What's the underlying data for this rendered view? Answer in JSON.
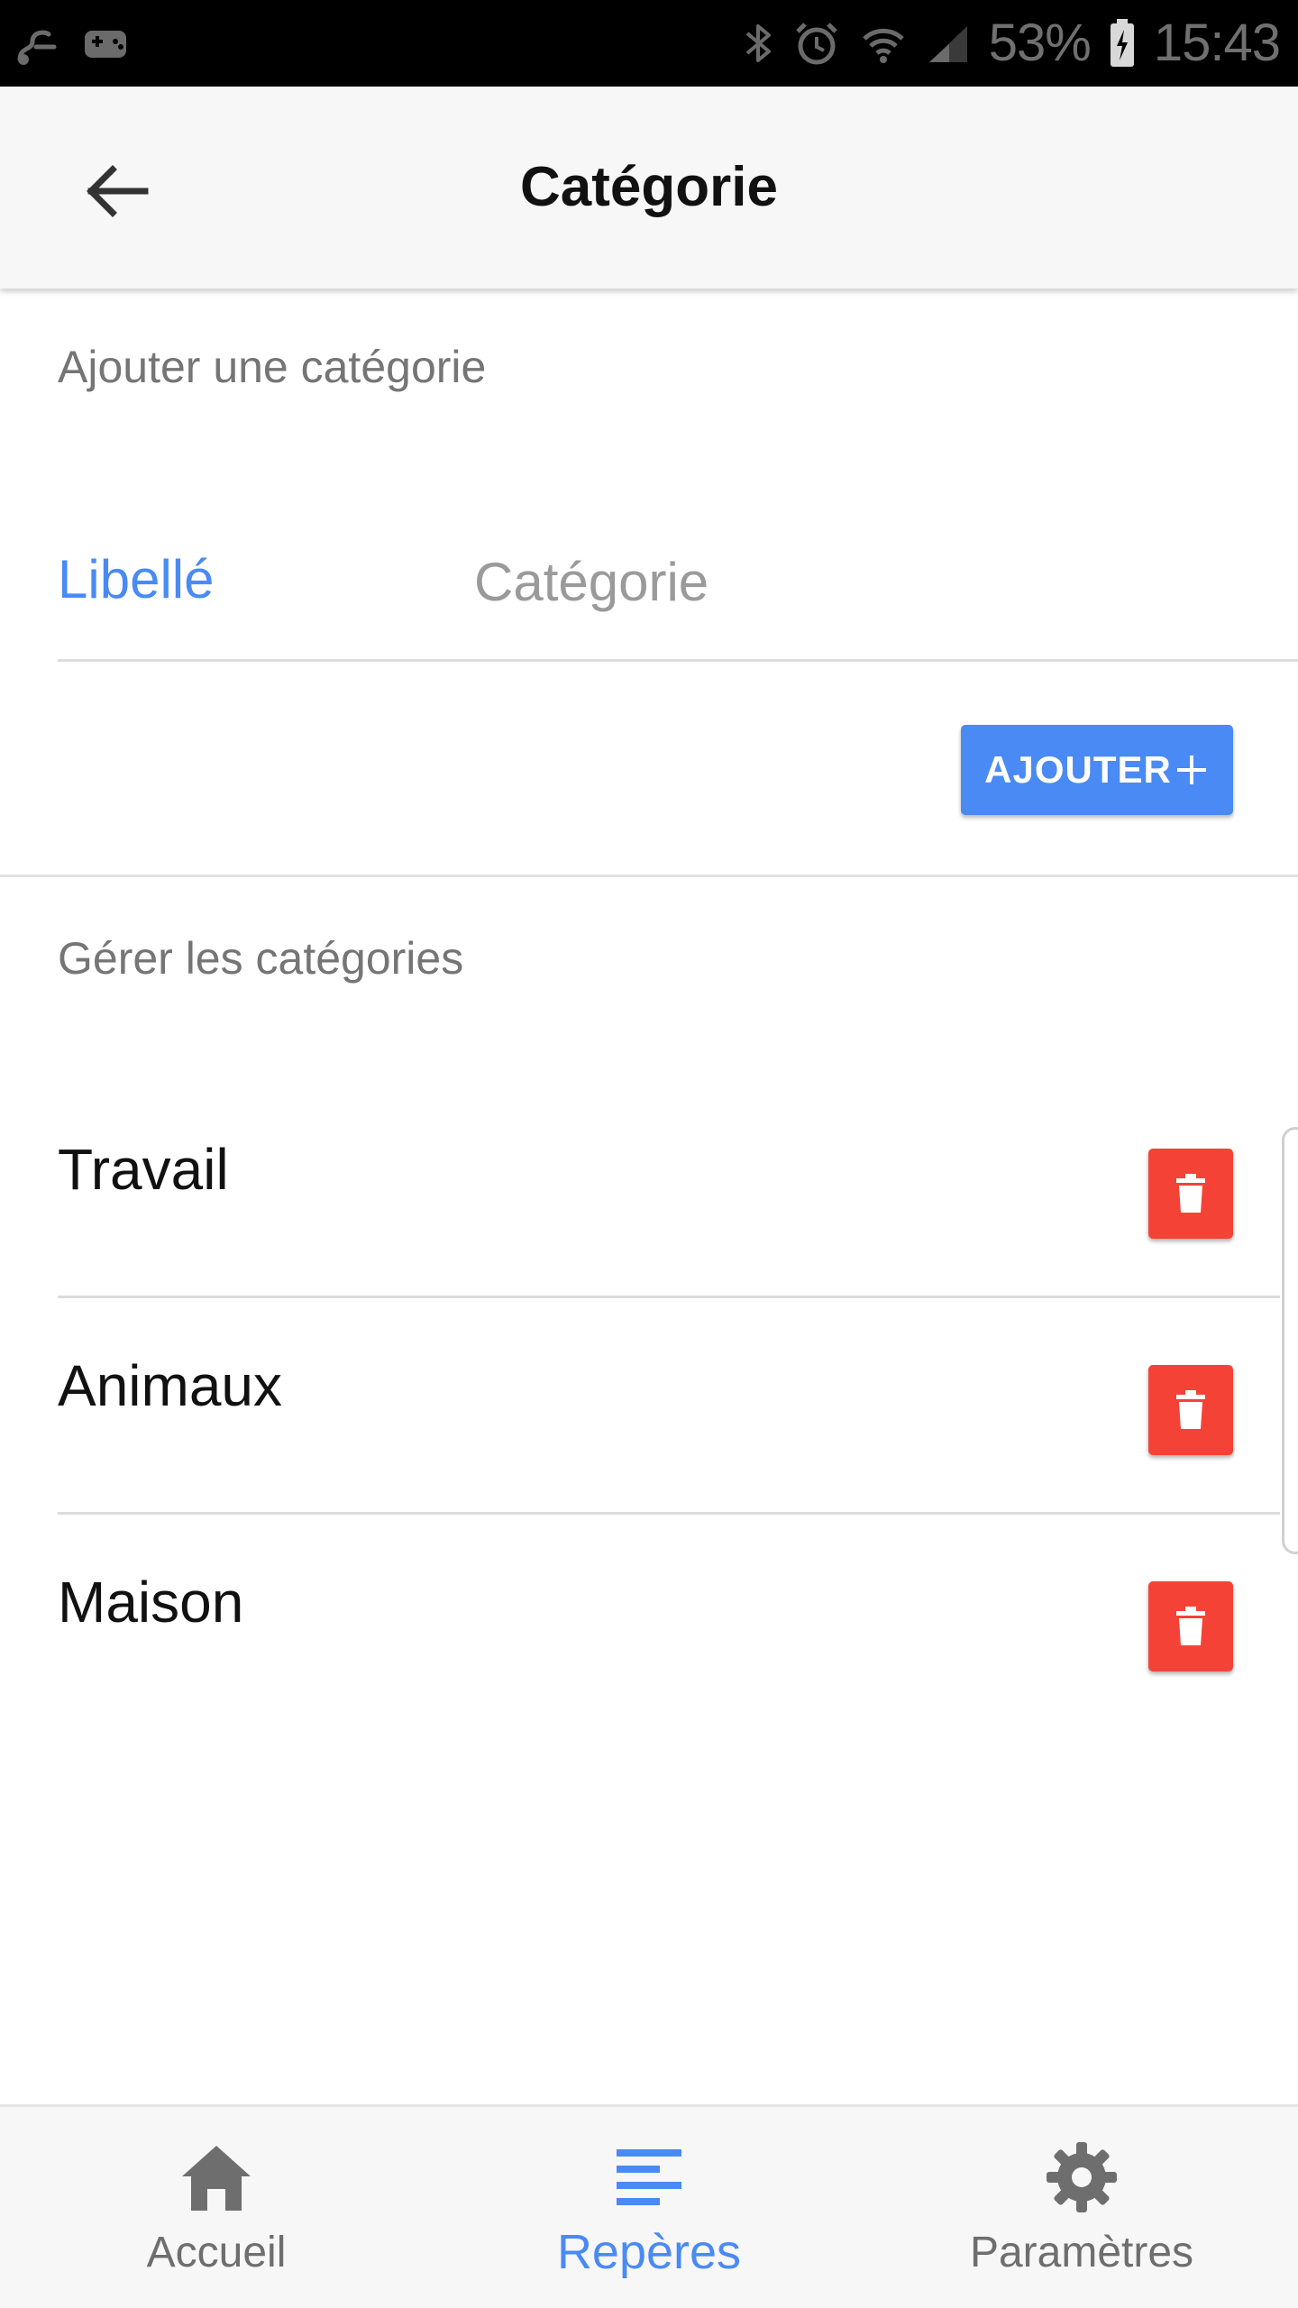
{
  "status_bar": {
    "battery": "53%",
    "time": "15:43"
  },
  "app_bar": {
    "title": "Catégorie"
  },
  "add_section": {
    "title": "Ajouter une catégorie",
    "input_label": "Libellé",
    "input_placeholder": "Catégorie",
    "input_value": "",
    "add_button_label": "AJOUTER"
  },
  "manage_section": {
    "title": "Gérer les catégories",
    "categories": [
      {
        "name": "Travail"
      },
      {
        "name": "Animaux"
      },
      {
        "name": "Maison"
      }
    ]
  },
  "bottom_nav": {
    "items": [
      {
        "label": "Accueil",
        "icon": "home-icon"
      },
      {
        "label": "Repères",
        "icon": "list-icon",
        "active": true
      },
      {
        "label": "Paramètres",
        "icon": "gear-icon"
      }
    ]
  },
  "colors": {
    "accent": "#4a8af4",
    "danger": "#f44336",
    "status_bar": "#000000",
    "app_bar": "#f7f7f7"
  }
}
